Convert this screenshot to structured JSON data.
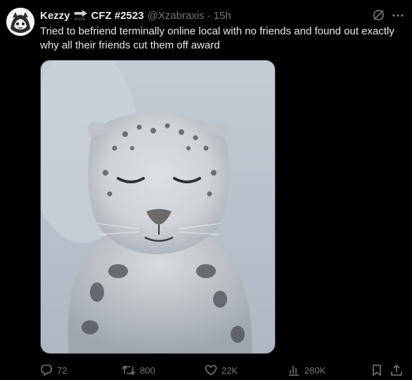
{
  "tweet": {
    "display_name": "Kezzy",
    "badge_text": "SOON",
    "name_suffix": "CFZ #2523",
    "handle": "@Xzabraxis",
    "separator": "·",
    "time": "15h",
    "text": "Tried to befriend terminally online local with no friends and found out exactly why all their friends cut them off award",
    "media_subject": "snow leopard photo"
  },
  "actions": {
    "reply_count": "72",
    "repost_count": "800",
    "like_count": "22K",
    "views_count": "280K"
  },
  "icons": {
    "grok": "grok-icon",
    "more": "more-icon",
    "reply": "reply-icon",
    "repost": "repost-icon",
    "like": "heart-icon",
    "views": "views-icon",
    "bookmark": "bookmark-icon",
    "share": "share-icon"
  },
  "colors": {
    "background": "#000000",
    "text": "#e7e9ea",
    "muted": "#71767b"
  }
}
